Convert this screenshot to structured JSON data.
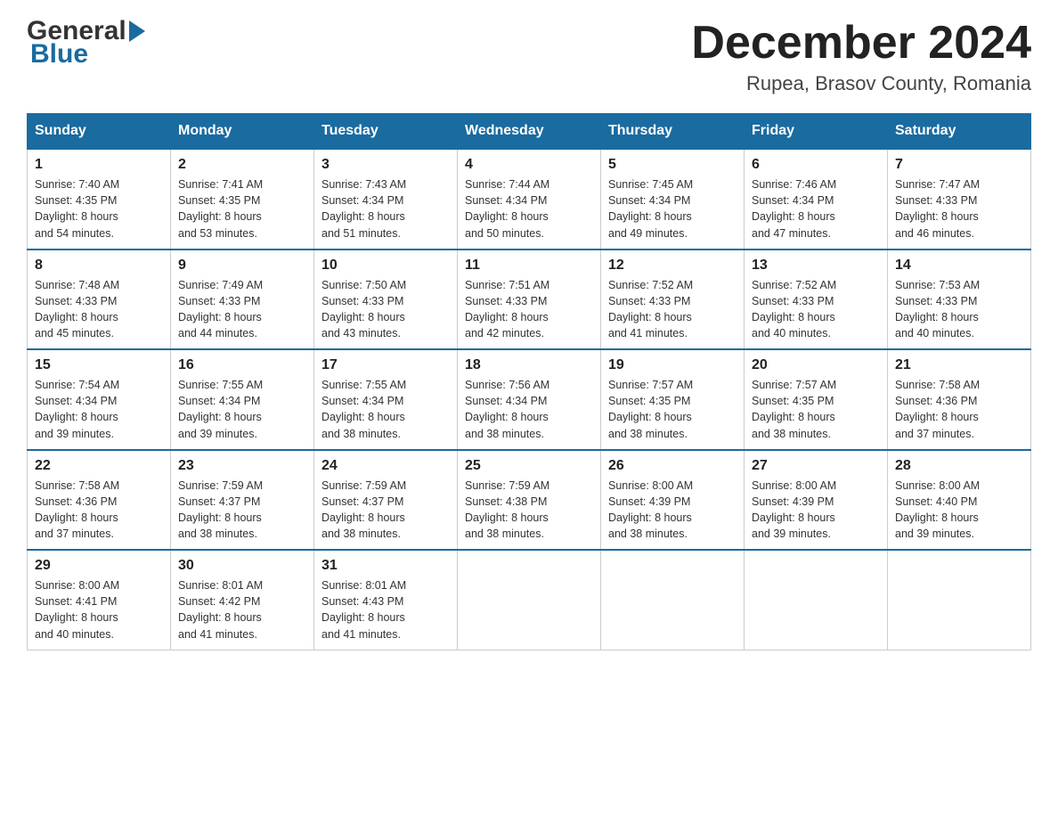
{
  "header": {
    "month_year": "December 2024",
    "location": "Rupea, Brasov County, Romania",
    "logo_general": "General",
    "logo_blue": "Blue"
  },
  "days_of_week": [
    "Sunday",
    "Monday",
    "Tuesday",
    "Wednesday",
    "Thursday",
    "Friday",
    "Saturday"
  ],
  "weeks": [
    [
      {
        "day": "1",
        "sunrise": "7:40 AM",
        "sunset": "4:35 PM",
        "daylight": "8 hours and 54 minutes."
      },
      {
        "day": "2",
        "sunrise": "7:41 AM",
        "sunset": "4:35 PM",
        "daylight": "8 hours and 53 minutes."
      },
      {
        "day": "3",
        "sunrise": "7:43 AM",
        "sunset": "4:34 PM",
        "daylight": "8 hours and 51 minutes."
      },
      {
        "day": "4",
        "sunrise": "7:44 AM",
        "sunset": "4:34 PM",
        "daylight": "8 hours and 50 minutes."
      },
      {
        "day": "5",
        "sunrise": "7:45 AM",
        "sunset": "4:34 PM",
        "daylight": "8 hours and 49 minutes."
      },
      {
        "day": "6",
        "sunrise": "7:46 AM",
        "sunset": "4:34 PM",
        "daylight": "8 hours and 47 minutes."
      },
      {
        "day": "7",
        "sunrise": "7:47 AM",
        "sunset": "4:33 PM",
        "daylight": "8 hours and 46 minutes."
      }
    ],
    [
      {
        "day": "8",
        "sunrise": "7:48 AM",
        "sunset": "4:33 PM",
        "daylight": "8 hours and 45 minutes."
      },
      {
        "day": "9",
        "sunrise": "7:49 AM",
        "sunset": "4:33 PM",
        "daylight": "8 hours and 44 minutes."
      },
      {
        "day": "10",
        "sunrise": "7:50 AM",
        "sunset": "4:33 PM",
        "daylight": "8 hours and 43 minutes."
      },
      {
        "day": "11",
        "sunrise": "7:51 AM",
        "sunset": "4:33 PM",
        "daylight": "8 hours and 42 minutes."
      },
      {
        "day": "12",
        "sunrise": "7:52 AM",
        "sunset": "4:33 PM",
        "daylight": "8 hours and 41 minutes."
      },
      {
        "day": "13",
        "sunrise": "7:52 AM",
        "sunset": "4:33 PM",
        "daylight": "8 hours and 40 minutes."
      },
      {
        "day": "14",
        "sunrise": "7:53 AM",
        "sunset": "4:33 PM",
        "daylight": "8 hours and 40 minutes."
      }
    ],
    [
      {
        "day": "15",
        "sunrise": "7:54 AM",
        "sunset": "4:34 PM",
        "daylight": "8 hours and 39 minutes."
      },
      {
        "day": "16",
        "sunrise": "7:55 AM",
        "sunset": "4:34 PM",
        "daylight": "8 hours and 39 minutes."
      },
      {
        "day": "17",
        "sunrise": "7:55 AM",
        "sunset": "4:34 PM",
        "daylight": "8 hours and 38 minutes."
      },
      {
        "day": "18",
        "sunrise": "7:56 AM",
        "sunset": "4:34 PM",
        "daylight": "8 hours and 38 minutes."
      },
      {
        "day": "19",
        "sunrise": "7:57 AM",
        "sunset": "4:35 PM",
        "daylight": "8 hours and 38 minutes."
      },
      {
        "day": "20",
        "sunrise": "7:57 AM",
        "sunset": "4:35 PM",
        "daylight": "8 hours and 38 minutes."
      },
      {
        "day": "21",
        "sunrise": "7:58 AM",
        "sunset": "4:36 PM",
        "daylight": "8 hours and 37 minutes."
      }
    ],
    [
      {
        "day": "22",
        "sunrise": "7:58 AM",
        "sunset": "4:36 PM",
        "daylight": "8 hours and 37 minutes."
      },
      {
        "day": "23",
        "sunrise": "7:59 AM",
        "sunset": "4:37 PM",
        "daylight": "8 hours and 38 minutes."
      },
      {
        "day": "24",
        "sunrise": "7:59 AM",
        "sunset": "4:37 PM",
        "daylight": "8 hours and 38 minutes."
      },
      {
        "day": "25",
        "sunrise": "7:59 AM",
        "sunset": "4:38 PM",
        "daylight": "8 hours and 38 minutes."
      },
      {
        "day": "26",
        "sunrise": "8:00 AM",
        "sunset": "4:39 PM",
        "daylight": "8 hours and 38 minutes."
      },
      {
        "day": "27",
        "sunrise": "8:00 AM",
        "sunset": "4:39 PM",
        "daylight": "8 hours and 39 minutes."
      },
      {
        "day": "28",
        "sunrise": "8:00 AM",
        "sunset": "4:40 PM",
        "daylight": "8 hours and 39 minutes."
      }
    ],
    [
      {
        "day": "29",
        "sunrise": "8:00 AM",
        "sunset": "4:41 PM",
        "daylight": "8 hours and 40 minutes."
      },
      {
        "day": "30",
        "sunrise": "8:01 AM",
        "sunset": "4:42 PM",
        "daylight": "8 hours and 41 minutes."
      },
      {
        "day": "31",
        "sunrise": "8:01 AM",
        "sunset": "4:43 PM",
        "daylight": "8 hours and 41 minutes."
      },
      null,
      null,
      null,
      null
    ]
  ],
  "labels": {
    "sunrise": "Sunrise:",
    "sunset": "Sunset:",
    "daylight": "Daylight:"
  }
}
